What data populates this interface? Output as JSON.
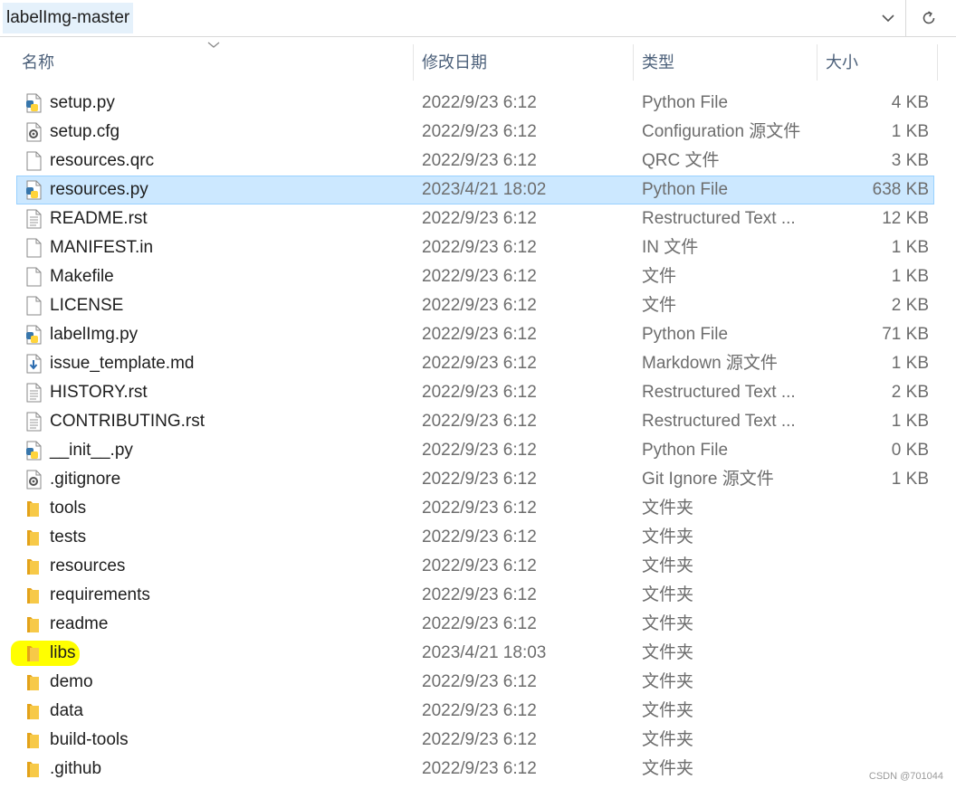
{
  "address_bar": {
    "path": "labelImg-master"
  },
  "columns": {
    "name": "名称",
    "date": "修改日期",
    "type": "类型",
    "size": "大小"
  },
  "colors": {
    "selection": "#cce8ff",
    "folder": "#f7c948",
    "highlight": "#ffff00"
  },
  "files": [
    {
      "name": "setup.py",
      "date": "2022/9/23 6:12",
      "type": "Python File",
      "size": "4 KB",
      "icon": "python-file-icon"
    },
    {
      "name": "setup.cfg",
      "date": "2022/9/23 6:12",
      "type": "Configuration 源文件",
      "size": "1 KB",
      "icon": "config-file-icon"
    },
    {
      "name": "resources.qrc",
      "date": "2022/9/23 6:12",
      "type": "QRC 文件",
      "size": "3 KB",
      "icon": "blank-file-icon"
    },
    {
      "name": "resources.py",
      "date": "2023/4/21 18:02",
      "type": "Python File",
      "size": "638 KB",
      "icon": "python-file-icon",
      "selected": true
    },
    {
      "name": "README.rst",
      "date": "2022/9/23 6:12",
      "type": "Restructured Text ...",
      "size": "12 KB",
      "icon": "text-file-icon"
    },
    {
      "name": "MANIFEST.in",
      "date": "2022/9/23 6:12",
      "type": "IN 文件",
      "size": "1 KB",
      "icon": "blank-file-icon"
    },
    {
      "name": "Makefile",
      "date": "2022/9/23 6:12",
      "type": "文件",
      "size": "1 KB",
      "icon": "blank-file-icon"
    },
    {
      "name": "LICENSE",
      "date": "2022/9/23 6:12",
      "type": "文件",
      "size": "2 KB",
      "icon": "blank-file-icon"
    },
    {
      "name": "labelImg.py",
      "date": "2022/9/23 6:12",
      "type": "Python File",
      "size": "71 KB",
      "icon": "python-file-icon"
    },
    {
      "name": "issue_template.md",
      "date": "2022/9/23 6:12",
      "type": "Markdown 源文件",
      "size": "1 KB",
      "icon": "markdown-file-icon"
    },
    {
      "name": "HISTORY.rst",
      "date": "2022/9/23 6:12",
      "type": "Restructured Text ...",
      "size": "2 KB",
      "icon": "text-file-icon"
    },
    {
      "name": "CONTRIBUTING.rst",
      "date": "2022/9/23 6:12",
      "type": "Restructured Text ...",
      "size": "1 KB",
      "icon": "text-file-icon"
    },
    {
      "name": "__init__.py",
      "date": "2022/9/23 6:12",
      "type": "Python File",
      "size": "0 KB",
      "icon": "python-file-icon"
    },
    {
      "name": ".gitignore",
      "date": "2022/9/23 6:12",
      "type": "Git Ignore 源文件",
      "size": "1 KB",
      "icon": "config-file-icon"
    },
    {
      "name": "tools",
      "date": "2022/9/23 6:12",
      "type": "文件夹",
      "size": "",
      "icon": "folder-icon"
    },
    {
      "name": "tests",
      "date": "2022/9/23 6:12",
      "type": "文件夹",
      "size": "",
      "icon": "folder-icon"
    },
    {
      "name": "resources",
      "date": "2022/9/23 6:12",
      "type": "文件夹",
      "size": "",
      "icon": "folder-icon"
    },
    {
      "name": "requirements",
      "date": "2022/9/23 6:12",
      "type": "文件夹",
      "size": "",
      "icon": "folder-icon"
    },
    {
      "name": "readme",
      "date": "2022/9/23 6:12",
      "type": "文件夹",
      "size": "",
      "icon": "folder-icon"
    },
    {
      "name": "libs",
      "date": "2023/4/21 18:03",
      "type": "文件夹",
      "size": "",
      "icon": "folder-icon",
      "highlighted": true
    },
    {
      "name": "demo",
      "date": "2022/9/23 6:12",
      "type": "文件夹",
      "size": "",
      "icon": "folder-icon"
    },
    {
      "name": "data",
      "date": "2022/9/23 6:12",
      "type": "文件夹",
      "size": "",
      "icon": "folder-icon"
    },
    {
      "name": "build-tools",
      "date": "2022/9/23 6:12",
      "type": "文件夹",
      "size": "",
      "icon": "folder-icon"
    },
    {
      "name": ".github",
      "date": "2022/9/23 6:12",
      "type": "文件夹",
      "size": "",
      "icon": "folder-icon"
    }
  ],
  "watermark": "CSDN @701044"
}
